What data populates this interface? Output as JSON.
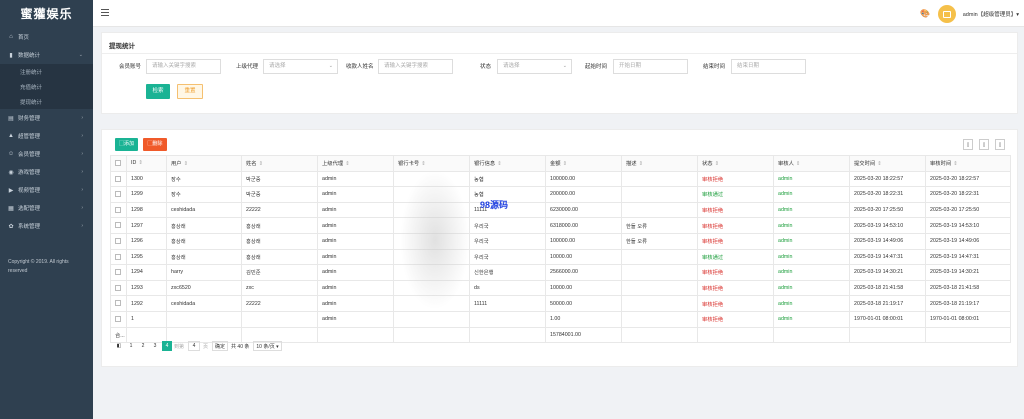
{
  "sidebar": {
    "brand": "蜜獾娱乐",
    "items": [
      {
        "label": "首页",
        "icon": "home-icon",
        "glyph": "⌂"
      },
      {
        "label": "数据统计",
        "icon": "chart-icon",
        "glyph": "▮",
        "arrow": "⌄"
      },
      {
        "label": "注册统计"
      },
      {
        "label": "充值统计"
      },
      {
        "label": "提现统计"
      },
      {
        "label": "财务管理",
        "icon": "bank-icon",
        "glyph": "▤",
        "arrow": "›"
      },
      {
        "label": "超管管理",
        "icon": "admin-icon",
        "glyph": "▲",
        "arrow": "›"
      },
      {
        "label": "会员管理",
        "icon": "users-icon",
        "glyph": "☺",
        "arrow": "›"
      },
      {
        "label": "游戏管理",
        "icon": "gamepad-icon",
        "glyph": "◉",
        "arrow": "›"
      },
      {
        "label": "视频管理",
        "icon": "video-icon",
        "glyph": "▶",
        "arrow": "›"
      },
      {
        "label": "选配管理",
        "icon": "config-icon",
        "glyph": "▦",
        "arrow": "›"
      },
      {
        "label": "系统管理",
        "icon": "gear-icon",
        "glyph": "✿",
        "arrow": "›"
      }
    ],
    "copyright": "Copyright © 2019. All rights reserved"
  },
  "header": {
    "user": "admin【超级管理员】▾"
  },
  "filter": {
    "title": "提现统计",
    "fields": [
      {
        "label": "会员账号",
        "placeholder": "请输入关键字搜索"
      },
      {
        "label": "上级代理",
        "placeholder": "请选择",
        "dropdown": "⌄"
      },
      {
        "label": "收款人姓名",
        "placeholder": "请输入关键字搜索"
      },
      {
        "label": "状态",
        "placeholder": "请选择",
        "dropdown": "⌄"
      },
      {
        "label": "起始时间",
        "placeholder": "开始日期"
      },
      {
        "label": "结束时间",
        "placeholder": "结束日期"
      }
    ],
    "search_label": "检索",
    "reset_label": "重置"
  },
  "toolbar": {
    "add_label": "▢添加",
    "delete_label": "▢删除",
    "icon_glyphs": [
      "▯",
      "▯",
      "▯"
    ]
  },
  "table": {
    "columns": [
      "ID",
      "用户",
      "姓名",
      "上级代理",
      "银行卡号",
      "银行信息",
      "金额",
      "描述",
      "状态",
      "审核人",
      "提交时间",
      "审核时间"
    ],
    "sort_glyph": "⇕",
    "rows": [
      [
        "1300",
        "장수",
        "박군중",
        "admin",
        "",
        "농협",
        "100000.00",
        "",
        "审核拒绝",
        "admin",
        "2025-03-20 18:22:57",
        "2025-03-20 18:22:57"
      ],
      [
        "1299",
        "장수",
        "박군중",
        "admin",
        "",
        "농협",
        "200000.00",
        "",
        "审核通过",
        "admin",
        "2025-03-20 18:22:31",
        "2025-03-20 18:22:31"
      ],
      [
        "1298",
        "ceshidada",
        "22222",
        "admin",
        "",
        "11111",
        "6230000.00",
        "",
        "审核拒绝",
        "admin",
        "2025-03-20 17:25:50",
        "2025-03-20 17:25:50"
      ],
      [
        "1297",
        "홍상래",
        "홍상래",
        "admin",
        "",
        "우리국",
        "6318000.00",
        "한들 오류",
        "审核拒绝",
        "admin",
        "2025-03-19 14:53:10",
        "2025-03-19 14:53:10"
      ],
      [
        "1296",
        "홍상래",
        "홍상래",
        "admin",
        "",
        "우리국",
        "100000.00",
        "한들 오류",
        "审核拒绝",
        "admin",
        "2025-03-19 14:49:06",
        "2025-03-19 14:49:06"
      ],
      [
        "1295",
        "홍상래",
        "홍상래",
        "admin",
        "",
        "우리국",
        "10000.00",
        "",
        "审核通过",
        "admin",
        "2025-03-19 14:47:31",
        "2025-03-19 14:47:31"
      ],
      [
        "1294",
        "harry",
        "김민준",
        "admin",
        "",
        "신한은행",
        "2566000.00",
        "",
        "审核拒绝",
        "admin",
        "2025-03-19 14:30:21",
        "2025-03-19 14:30:21"
      ],
      [
        "1293",
        "zxc6520",
        "zxc",
        "admin",
        "",
        "ds",
        "10000.00",
        "",
        "审核拒绝",
        "admin",
        "2025-03-18 21:41:58",
        "2025-03-18 21:41:58"
      ],
      [
        "1292",
        "ceshidada",
        "22222",
        "admin",
        "",
        "11111",
        "50000.00",
        "",
        "审核拒绝",
        "admin",
        "2025-03-18 21:19:17",
        "2025-03-18 21:19:17"
      ],
      [
        "1",
        "",
        "",
        "admin",
        "",
        "",
        "1.00",
        "",
        "审核拒绝",
        "admin",
        "1970-01-01 08:00:01",
        "1970-01-01 08:00:01"
      ]
    ],
    "total_label": "合...",
    "total_amount": "15784001.00"
  },
  "watermark": "98源码",
  "pager": {
    "prev": "◧",
    "pages": [
      "1",
      "2",
      "3",
      "4"
    ],
    "current": "4",
    "goto_label": "到第",
    "goto_value": "4",
    "page_unit": "页",
    "confirm_label": "确定",
    "total": "共 40 条",
    "page_size": "10 条/页 ▾"
  },
  "colors": {
    "sidebar": "#2f4050",
    "primary": "#1ab394",
    "danger": "#f05a2a",
    "rejected": "#d9302c",
    "approved": "#1a9d3a"
  }
}
